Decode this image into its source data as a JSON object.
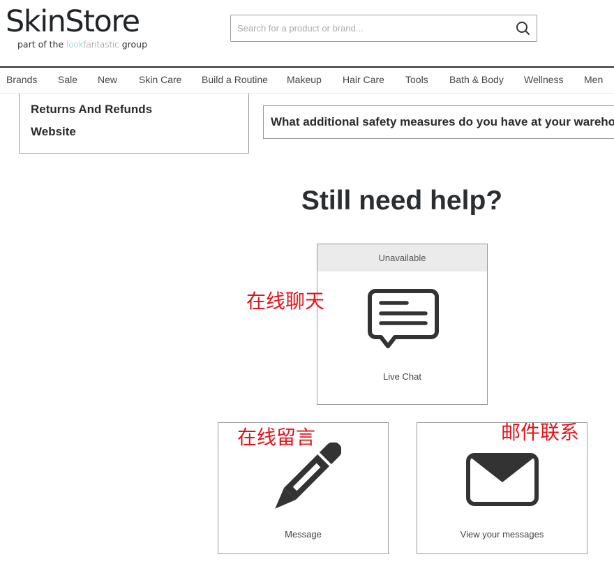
{
  "header": {
    "logo": "SkinStore",
    "tagline_prefix": "part of the ",
    "tagline_brand_a": "look",
    "tagline_brand_b": "fantastic",
    "tagline_suffix": " group",
    "search_placeholder": "Search for a product or brand...",
    "search_value": ""
  },
  "nav": {
    "items": [
      "Brands",
      "Sale",
      "New",
      "Skin Care",
      "Build a Routine",
      "Makeup",
      "Hair Care",
      "Tools",
      "Bath & Body",
      "Wellness",
      "Men"
    ]
  },
  "topics": {
    "items": [
      "Returns And Refunds",
      "Website"
    ]
  },
  "faq": {
    "question": "What additional safety measures do you have at your warehouse?"
  },
  "help": {
    "title": "Still need help?",
    "cards": [
      {
        "label": "Live Chat",
        "status": "Unavailable",
        "icon": "chat-bubble-icon"
      },
      {
        "label": "Message",
        "icon": "pencil-icon"
      },
      {
        "label": "View your messages",
        "icon": "envelope-icon"
      }
    ]
  },
  "annotations": {
    "live_chat": "在线聊天",
    "message": "在线留言",
    "email": "邮件联系",
    "color": "#e4141b"
  }
}
